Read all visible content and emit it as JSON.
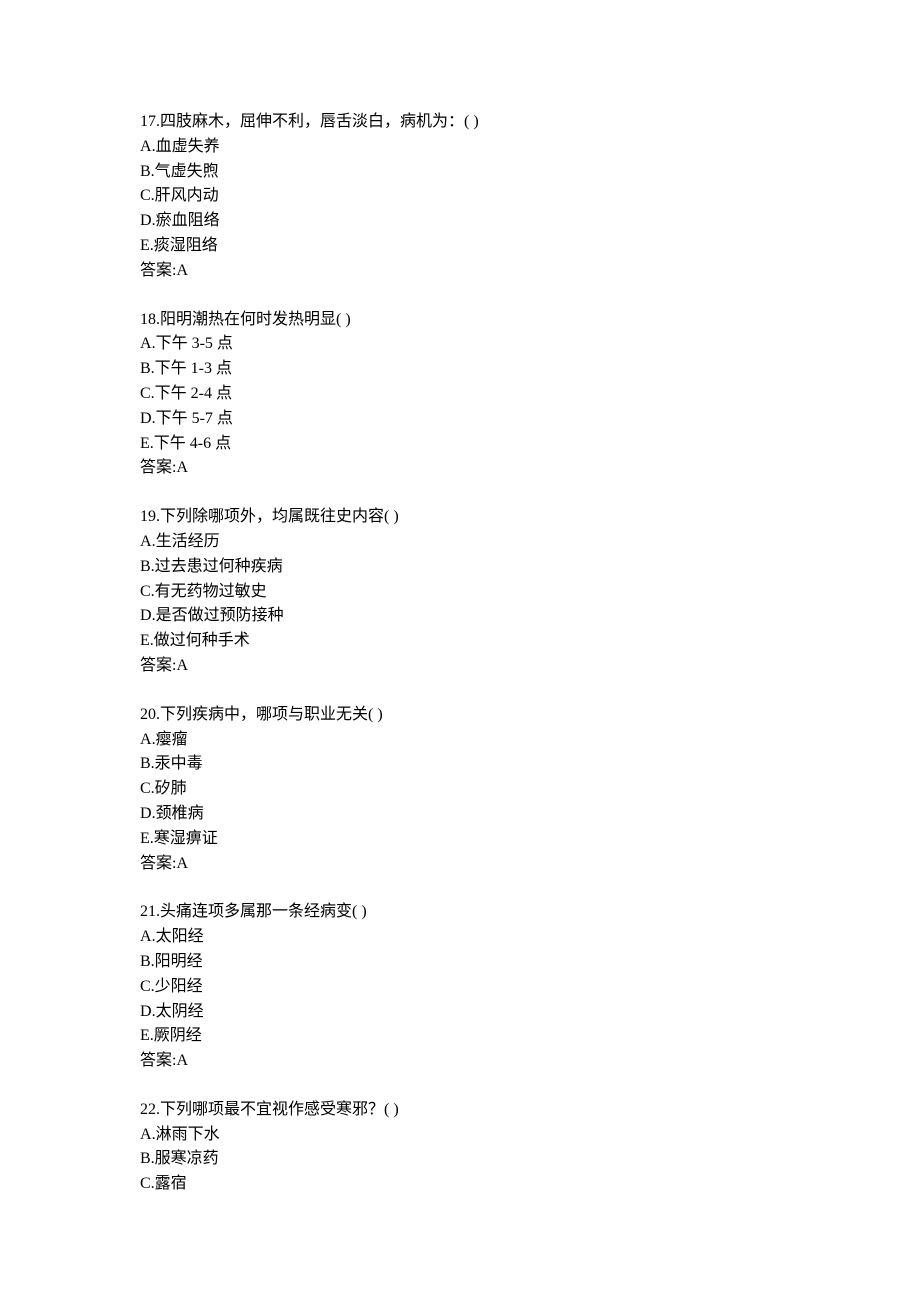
{
  "questions": [
    {
      "number": "17",
      "stem": "四肢麻木，屈伸不利，唇舌淡白，病机为：( )",
      "options": [
        {
          "label": "A",
          "text": "血虚失养"
        },
        {
          "label": "B",
          "text": "气虚失煦"
        },
        {
          "label": "C",
          "text": "肝风内动"
        },
        {
          "label": "D",
          "text": "瘀血阻络"
        },
        {
          "label": "E",
          "text": "痰湿阻络"
        }
      ],
      "answer_label": "答案:",
      "answer_value": "A"
    },
    {
      "number": "18",
      "stem": "阳明潮热在何时发热明显( )",
      "options": [
        {
          "label": "A",
          "text": "下午 3-5 点"
        },
        {
          "label": "B",
          "text": "下午 1-3 点"
        },
        {
          "label": "C",
          "text": "下午 2-4 点"
        },
        {
          "label": "D",
          "text": "下午 5-7 点"
        },
        {
          "label": "E",
          "text": "下午 4-6 点"
        }
      ],
      "answer_label": "答案:",
      "answer_value": "A"
    },
    {
      "number": "19",
      "stem": "下列除哪项外，均属既往史内容( )",
      "options": [
        {
          "label": "A",
          "text": "生活经历"
        },
        {
          "label": "B",
          "text": "过去患过何种疾病"
        },
        {
          "label": "C",
          "text": "有无药物过敏史"
        },
        {
          "label": "D",
          "text": "是否做过预防接种"
        },
        {
          "label": "E",
          "text": "做过何种手术"
        }
      ],
      "answer_label": "答案:",
      "answer_value": "A"
    },
    {
      "number": "20",
      "stem": "下列疾病中，哪项与职业无关( )",
      "options": [
        {
          "label": "A",
          "text": "瘿瘤"
        },
        {
          "label": "B",
          "text": "汞中毒"
        },
        {
          "label": "C",
          "text": "矽肺"
        },
        {
          "label": "D",
          "text": "颈椎病"
        },
        {
          "label": "E",
          "text": "寒湿痹证"
        }
      ],
      "answer_label": "答案:",
      "answer_value": "A"
    },
    {
      "number": "21",
      "stem": "头痛连项多属那一条经病变( )",
      "options": [
        {
          "label": "A",
          "text": "太阳经"
        },
        {
          "label": "B",
          "text": "阳明经"
        },
        {
          "label": "C",
          "text": "少阳经"
        },
        {
          "label": "D",
          "text": "太阴经"
        },
        {
          "label": "E",
          "text": "厥阴经"
        }
      ],
      "answer_label": "答案:",
      "answer_value": "A"
    },
    {
      "number": "22",
      "stem": "下列哪项最不宜视作感受寒邪？( )",
      "options": [
        {
          "label": "A",
          "text": "淋雨下水"
        },
        {
          "label": "B",
          "text": "服寒凉药"
        },
        {
          "label": "C",
          "text": "露宿"
        }
      ],
      "answer_label": "",
      "answer_value": ""
    }
  ]
}
